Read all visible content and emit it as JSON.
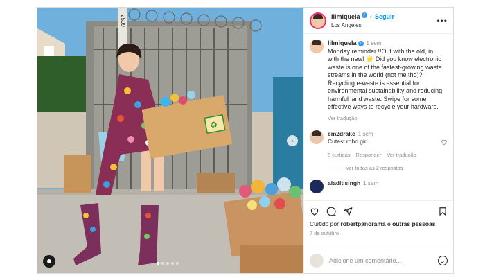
{
  "post": {
    "username": "lilmiquela",
    "follow_label": "Seguir",
    "location": "Los Angeles",
    "more_label": "•••"
  },
  "caption": {
    "username": "lilmiquela",
    "time": "1 sem",
    "text": "Monday reminder !!Out with the old, in with the new! 🌟 Did you know electronic waste is one of the fastest-growing waste streams in the world (not me tho)? Recycling e-waste is essential for environmental sustainability and reducing harmful land waste. Swipe for some effective ways to recycle your hardware.",
    "translate_label": "Ver tradução"
  },
  "comments": [
    {
      "username": "em2drake",
      "time": "1 sem",
      "text": "Cutest robo girl",
      "likes": "8 curtidas",
      "reply_label": "Responder",
      "translate_label": "Ver tradução",
      "replies_label": "Ver todas as 2 respostas"
    },
    {
      "username": "aiaditisingh",
      "time": "1 sem"
    }
  ],
  "stats": {
    "liked_prefix": "Curtido por",
    "liked_user": "robertpanorama",
    "liked_and": "e",
    "liked_others": "outras pessoas",
    "date": "7 de outubro"
  },
  "add_comment": {
    "placeholder": "Adicione um comentário..."
  },
  "media": {
    "address_number": "2509",
    "carousel_count": 5,
    "carousel_active": 1
  },
  "colors": {
    "accent": "#0095f6",
    "verified": "#3897f0",
    "sky": "#6fb0dc"
  }
}
